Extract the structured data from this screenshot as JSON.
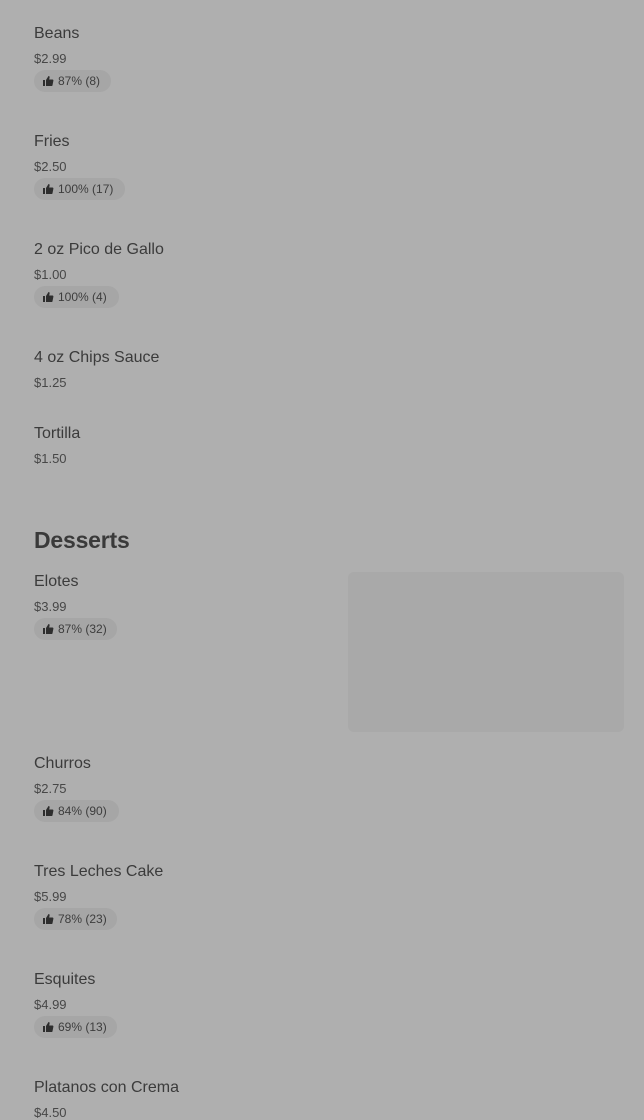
{
  "sides": [
    {
      "name": "Beans",
      "price": "$2.99",
      "rating": "87% (8)"
    },
    {
      "name": "Fries",
      "price": "$2.50",
      "rating": "100% (17)"
    },
    {
      "name": "2 oz Pico de Gallo",
      "price": "$1.00",
      "rating": "100% (4)"
    },
    {
      "name": "4 oz Chips Sauce",
      "price": "$1.25",
      "rating": ""
    },
    {
      "name": "Tortilla",
      "price": "$1.50",
      "rating": ""
    }
  ],
  "desserts": {
    "title": "Desserts",
    "items": [
      {
        "name": "Elotes",
        "price": "$3.99",
        "rating": "87% (32)"
      },
      {
        "name": "Churros",
        "price": "$2.75",
        "rating": "84% (90)"
      },
      {
        "name": "Tres Leches Cake",
        "price": "$5.99",
        "rating": "78% (23)"
      },
      {
        "name": "Esquites",
        "price": "$4.99",
        "rating": "69% (13)"
      },
      {
        "name": "Platanos con Crema",
        "price": "$4.50",
        "rating": ""
      }
    ]
  },
  "icons": {
    "rating": "thumbs-up-icon"
  },
  "colors": {
    "background": "#afafaf",
    "chip": "#a6a6a6",
    "text": "#3d3d3d"
  }
}
